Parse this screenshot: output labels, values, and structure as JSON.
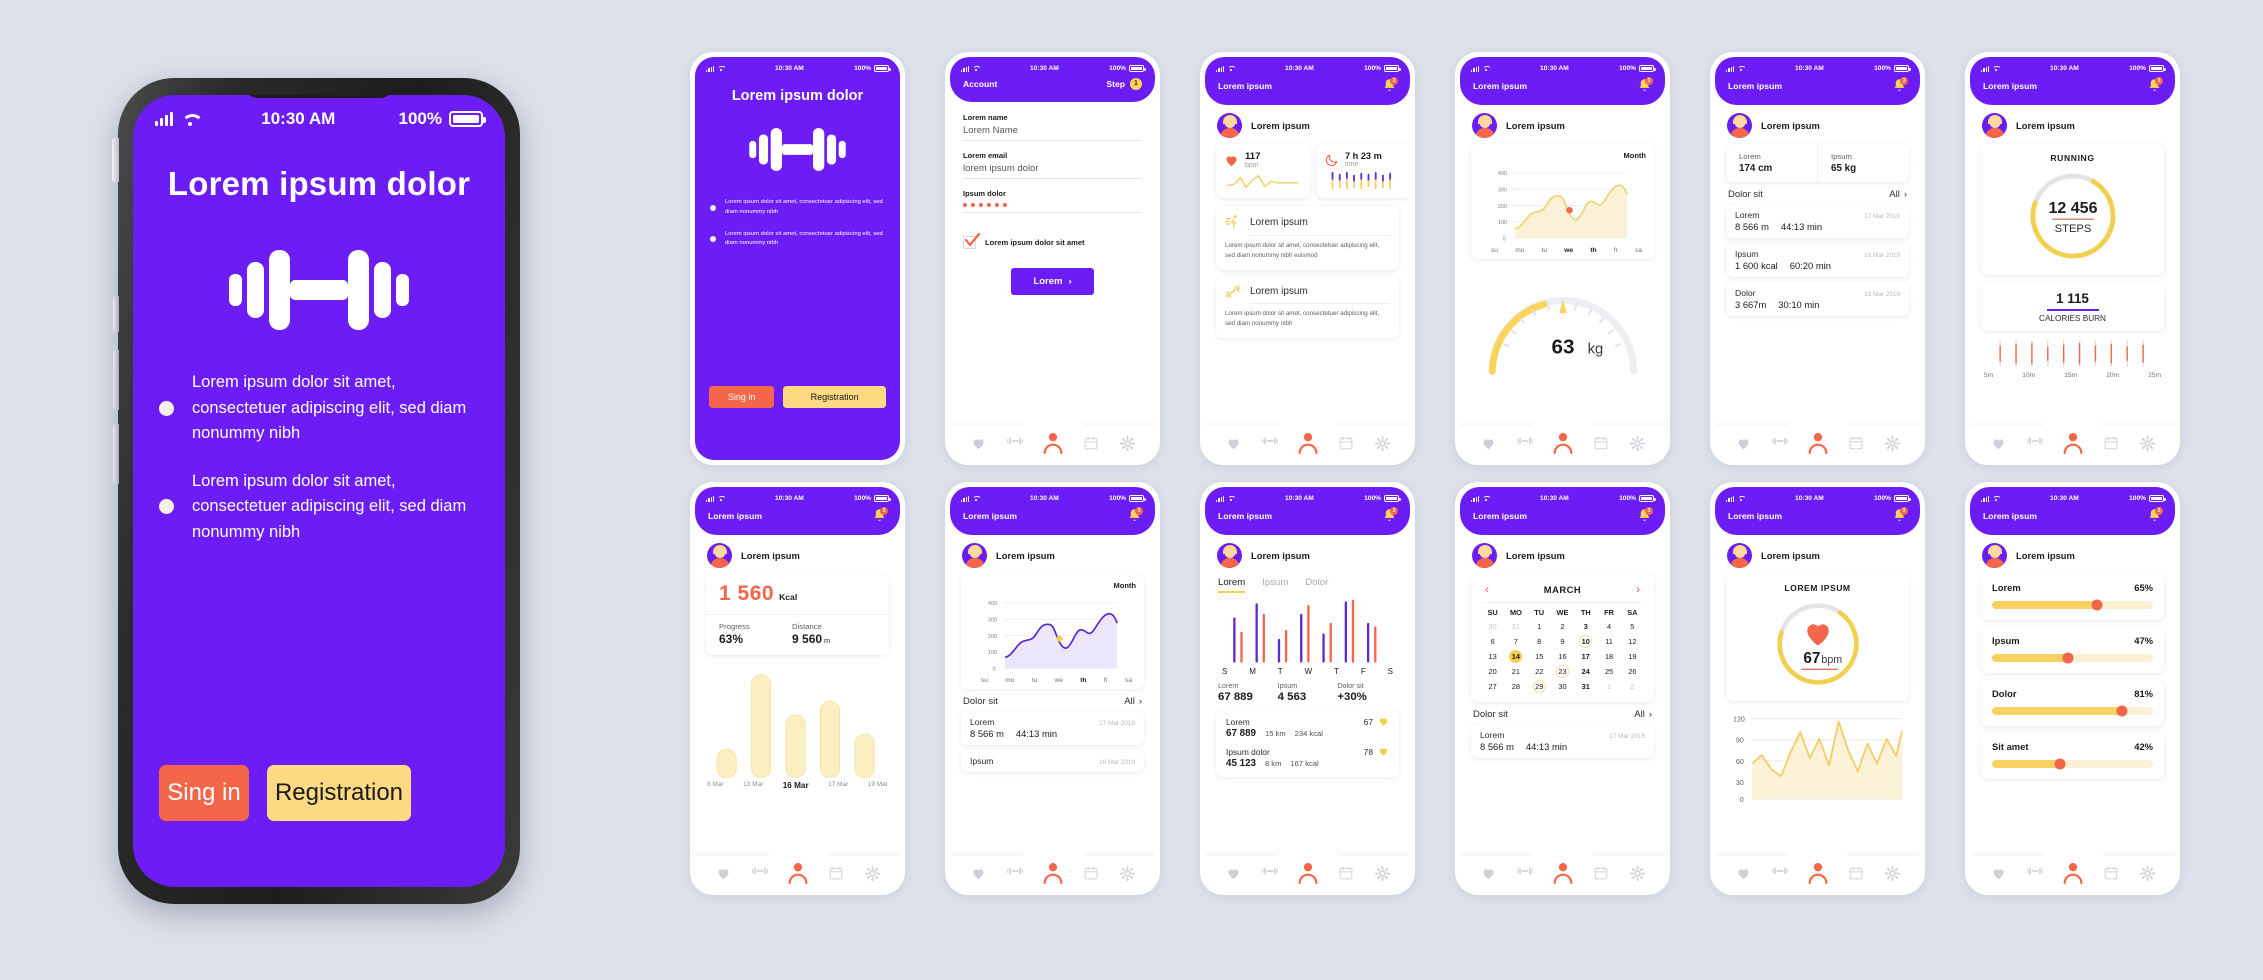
{
  "theme": {
    "background": "#dde1ea",
    "primary_purple": "#6c1df5",
    "accent_orange": "#f4664a",
    "accent_yellow": "#fcd982",
    "text_dark": "#1b1b1b"
  },
  "status_bar": {
    "time": "10:30 AM",
    "battery": "100%"
  },
  "big_phone": {
    "title": "Lorem ipsum dolor",
    "icon": "dumbbell-icon",
    "bullets": [
      "Lorem ipsum dolor sit amet, consectetuer adipiscing elit, sed diam nonummy nibh",
      "Lorem ipsum dolor sit amet, consectetuer adipiscing elit, sed diam nonummy nibh"
    ],
    "sign_in_label": "Sing in",
    "registration_label": "Registration"
  },
  "screens": [
    {
      "id": "onboarding",
      "title": "Lorem ipsum dolor",
      "sign_in_label": "Sing in",
      "registration_label": "Registration",
      "bullets": [
        "Lorem ipsum dolor sit amet, consectetuer adipiscing elit, sed diam nonummy nibh",
        "Lorem ipsum dolor sit amet, consectetuer adipiscing elit, sed diam nonummy nibh"
      ]
    },
    {
      "id": "account",
      "nav_title": "Account",
      "step_label": "Step",
      "step_number": "1",
      "fields": [
        {
          "label": "Lorem name",
          "value": "Lorem Name"
        },
        {
          "label": "Lorem email",
          "value": "lorem ipsum dolor"
        },
        {
          "label": "Ipsum dolor",
          "value": "••••••"
        }
      ],
      "checkbox_label": "Lorem ipsum dolor sit amet",
      "checkbox_checked": true,
      "submit_label": "Lorem"
    },
    {
      "id": "dashboard",
      "nav_title": "Lorem ipsum",
      "notifications": "3",
      "profile_name": "Lorem ipsum",
      "stat_cards": [
        {
          "icon": "heart-icon",
          "value": "117",
          "unit": "bpm",
          "graph": "pulse-line"
        },
        {
          "icon": "moon-icon",
          "value": "7 h 23 m",
          "unit": "time",
          "graph": "sleep-bars"
        }
      ],
      "info_cards": [
        {
          "icon": "running-icon",
          "title": "Lorem ipsum",
          "text": "Lorem ipsum dolor sit amet, consectetuer adipiscing elit, sed diam nonummy nibh euismod"
        },
        {
          "icon": "dumbbell-icon",
          "title": "Lorem ipsum",
          "text": "Lorem ipsum dolor sit amet, consectetuer adipiscing elit, sed diam nonummy nibh"
        }
      ]
    },
    {
      "id": "weight",
      "nav_title": "Lorem ipsum",
      "notifications": "3",
      "profile_name": "Lorem ipsum",
      "chart_period": "Month",
      "gauge_value": "63",
      "gauge_unit": "kg"
    },
    {
      "id": "measurements",
      "nav_title": "Lorem ipsum",
      "notifications": "3",
      "profile_name": "Lorem ipsum",
      "metrics": [
        {
          "label": "Lorem",
          "value": "174 cm"
        },
        {
          "label": "Ipsum",
          "value": "65 kg"
        }
      ],
      "section_title": "Dolor sit",
      "section_action": "All",
      "activities": [
        {
          "label": "Lorem",
          "date": "17 Mar 2019",
          "v1": "8 566 m",
          "v2": "44:13 min"
        },
        {
          "label": "Ipsum",
          "date": "16 Mar 2019",
          "v1": "1 600 kcal",
          "v2": "60:20 min"
        },
        {
          "label": "Dolor",
          "date": "13 Mar 2019",
          "v1": "3 667m",
          "v2": "30:10 min"
        }
      ]
    },
    {
      "id": "running",
      "nav_title": "Lorem ipsum",
      "notifications": "3",
      "profile_name": "Lorem ipsum",
      "ring_title": "RUNNING",
      "steps_value": "12 456",
      "steps_label": "STEPS",
      "calories_value": "1 115",
      "calories_label": "CALORIES BURN",
      "timeline_labels": [
        "5m",
        "10m",
        "15m",
        "20m",
        "25m"
      ]
    },
    {
      "id": "calories",
      "nav_title": "Lorem ipsum",
      "notifications": "3",
      "profile_name": "Lorem ipsum",
      "kcal_value": "1 560",
      "kcal_unit": "Kcal",
      "stats": [
        {
          "label": "Progress",
          "value": "63%"
        },
        {
          "label": "Distance",
          "value": "9 560",
          "unit": "m"
        }
      ]
    },
    {
      "id": "activity-chart",
      "nav_title": "Lorem ipsum",
      "notifications": "3",
      "profile_name": "Lorem ipsum",
      "chart_period": "Month",
      "section_title": "Dolor sit",
      "section_action": "All",
      "activities": [
        {
          "label": "Lorem",
          "date": "17 Mar 2019",
          "v1": "8 566 m",
          "v2": "44:13 min"
        },
        {
          "label": "Ipsum",
          "date": "16 Mar 2019",
          "v1": "",
          "v2": ""
        }
      ]
    },
    {
      "id": "weekly-bars",
      "nav_title": "Lorem ipsum",
      "notifications": "3",
      "profile_name": "Lorem ipsum",
      "tabs": [
        "Lorem",
        "Ipsum",
        "Dolor"
      ],
      "active_tab": "Lorem",
      "summary": [
        {
          "label": "Lorem",
          "value": "67 889"
        },
        {
          "label": "Ipsum",
          "value": "4 563"
        },
        {
          "label": "Dolor sit",
          "value": "+30%"
        }
      ],
      "rows": [
        {
          "label": "Lorem",
          "bpm": "67",
          "value": "67 889",
          "dist": "15 km",
          "kcal": "234 kcal"
        },
        {
          "label": "Ipsum dolor",
          "bpm": "78",
          "value": "45 123",
          "dist": "8 km",
          "kcal": "167 kcal"
        }
      ]
    },
    {
      "id": "calendar",
      "nav_title": "Lorem ipsum",
      "notifications": "3",
      "profile_name": "Lorem ipsum",
      "month": "MARCH",
      "weekday_headers": [
        "SU",
        "MO",
        "TU",
        "WE",
        "TH",
        "FR",
        "SA"
      ],
      "section_title": "Dolor sit",
      "section_action": "All",
      "activity": {
        "label": "Lorem",
        "date": "17 Mar 2019",
        "v1": "8 566 m",
        "v2": "44:13 min"
      }
    },
    {
      "id": "heart-rate",
      "nav_title": "Lorem ipsum",
      "notifications": "3",
      "profile_name": "Lorem ipsum",
      "ring_title": "LOREM IPSUM",
      "bpm_value": "67",
      "bpm_unit": "bpm"
    },
    {
      "id": "sliders",
      "nav_title": "Lorem ipsum",
      "notifications": "3",
      "profile_name": "Lorem ipsum",
      "sliders": [
        {
          "label": "Lorem",
          "value": "65%",
          "pct": 65
        },
        {
          "label": "Ipsum",
          "value": "47%",
          "pct": 47
        },
        {
          "label": "Dolor",
          "value": "81%",
          "pct": 81
        },
        {
          "label": "Sit amet",
          "value": "42%",
          "pct": 42
        }
      ]
    }
  ],
  "tab_icons": [
    "heart-icon",
    "dumbbell-icon",
    "person-icon",
    "calendar-icon",
    "gear-icon"
  ],
  "chart_data": [
    {
      "id": "weight-month-area",
      "type": "area",
      "title": "Month",
      "categories": [
        "su",
        "mo",
        "tu",
        "we",
        "th",
        "fr",
        "sa"
      ],
      "values": [
        50,
        160,
        230,
        130,
        210,
        180,
        270
      ],
      "ylim": [
        0,
        400
      ],
      "yticks": [
        0,
        100,
        200,
        300,
        400
      ],
      "grid": true,
      "marker_point": {
        "x": "we",
        "y": 190
      },
      "color": "#f2cf6a"
    },
    {
      "id": "activity-month-area",
      "type": "area",
      "title": "Month",
      "categories": [
        "su",
        "mo",
        "tu",
        "we",
        "th",
        "fr",
        "sa"
      ],
      "values": [
        55,
        165,
        235,
        135,
        215,
        185,
        265
      ],
      "ylim": [
        0,
        400
      ],
      "yticks": [
        0,
        100,
        200,
        300,
        400
      ],
      "grid": true,
      "marker_point": {
        "x": "we",
        "y": 185
      },
      "color": "#5b2ad0"
    },
    {
      "id": "calories-bars",
      "type": "bar",
      "categories": [
        "8 Mar",
        "13 Mar",
        "16 Mar",
        "17 Mar",
        "19 Mar"
      ],
      "values": [
        18,
        100,
        58,
        72,
        34
      ],
      "highlight_index": 2,
      "color": "#fbeec0"
    },
    {
      "id": "weekly-dual-bars",
      "type": "bar",
      "categories": [
        "S",
        "M",
        "T",
        "W",
        "T",
        "F",
        "S"
      ],
      "series": [
        {
          "name": "purple",
          "values": [
            62,
            86,
            34,
            70,
            42,
            92,
            56
          ]
        },
        {
          "name": "orange",
          "values": [
            48,
            68,
            46,
            88,
            56,
            96,
            52
          ]
        }
      ],
      "colors": [
        "#5b2ad0",
        "#f4664a"
      ]
    },
    {
      "id": "heart-rate-line",
      "type": "area",
      "ylim": [
        0,
        120
      ],
      "yticks": [
        0,
        30,
        60,
        90,
        120
      ],
      "values": [
        50,
        65,
        45,
        38,
        68,
        96,
        62,
        88,
        52,
        112,
        70,
        44,
        78,
        50,
        82,
        58,
        90
      ],
      "grid": true,
      "color": "#f2cf6a"
    },
    {
      "id": "weight-gauge",
      "type": "gauge",
      "value": 63,
      "unit": "kg",
      "color": "#fcd45a"
    },
    {
      "id": "steps-ring",
      "type": "gauge",
      "value": 12456,
      "label": "STEPS",
      "percent": 72,
      "color": "#f2cf4e"
    },
    {
      "id": "bpm-ring",
      "type": "gauge",
      "value": 67,
      "unit": "bpm",
      "percent": 70,
      "color": "#f2cf4e"
    }
  ],
  "calendar_weeks": [
    [
      {
        "d": "30",
        "m": 1
      },
      {
        "d": "31",
        "m": 1
      },
      {
        "d": "1"
      },
      {
        "d": "2"
      },
      {
        "d": "3",
        "b": 1
      },
      {
        "d": "4"
      },
      {
        "d": "5"
      }
    ],
    [
      {
        "d": "6"
      },
      {
        "d": "7"
      },
      {
        "d": "8"
      },
      {
        "d": "9"
      },
      {
        "d": "10",
        "b": 1,
        "o": 1
      },
      {
        "d": "11"
      },
      {
        "d": "12"
      }
    ],
    [
      {
        "d": "13"
      },
      {
        "d": "14",
        "sel": 1
      },
      {
        "d": "15"
      },
      {
        "d": "16"
      },
      {
        "d": "17",
        "b": 1
      },
      {
        "d": "18"
      },
      {
        "d": "19"
      }
    ],
    [
      {
        "d": "20"
      },
      {
        "d": "21"
      },
      {
        "d": "22"
      },
      {
        "d": "23",
        "o": 1
      },
      {
        "d": "24",
        "b": 1
      },
      {
        "d": "25"
      },
      {
        "d": "26"
      }
    ],
    [
      {
        "d": "27"
      },
      {
        "d": "28"
      },
      {
        "d": "29",
        "o": 1
      },
      {
        "d": "30"
      },
      {
        "d": "31",
        "b": 1
      },
      {
        "d": "1",
        "m": 1
      },
      {
        "d": "2",
        "m": 1
      }
    ]
  ]
}
